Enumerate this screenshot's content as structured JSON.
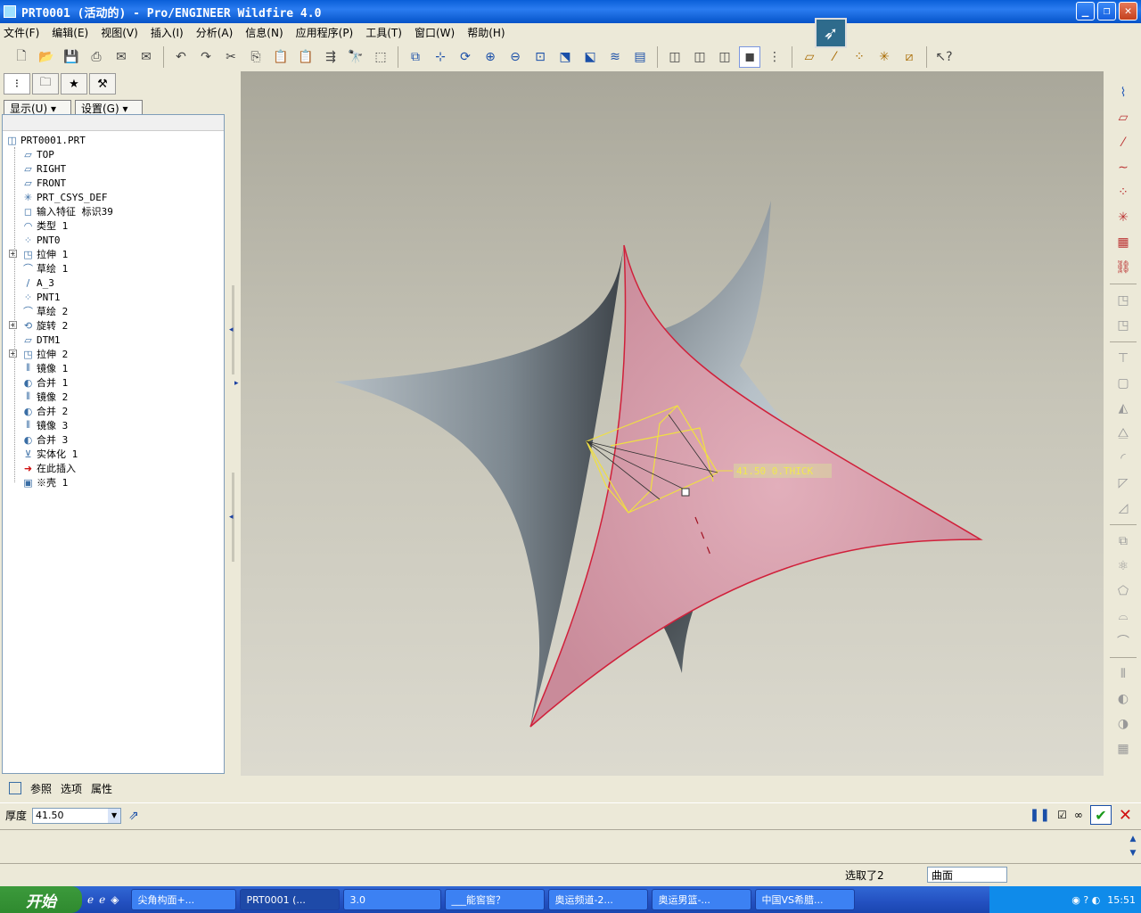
{
  "window": {
    "title": "PRT0001 (活动的) - Pro/ENGINEER Wildfire 4.0",
    "minimize": "_",
    "maximize": "❐",
    "close": "✕"
  },
  "menu": [
    "文件(F)",
    "编辑(E)",
    "视图(V)",
    "插入(I)",
    "分析(A)",
    "信息(N)",
    "应用程序(P)",
    "工具(T)",
    "窗口(W)",
    "帮助(H)"
  ],
  "panel": {
    "show_label": "显示(U) ▾",
    "settings_label": "设置(G) ▾"
  },
  "tree": [
    {
      "label": "PRT0001.PRT",
      "icon": "part-icon",
      "glyph": "◫"
    },
    {
      "label": "TOP",
      "icon": "datum-plane-icon",
      "glyph": "▱"
    },
    {
      "label": "RIGHT",
      "icon": "datum-plane-icon",
      "glyph": "▱"
    },
    {
      "label": "FRONT",
      "icon": "datum-plane-icon",
      "glyph": "▱"
    },
    {
      "label": "PRT_CSYS_DEF",
      "icon": "csys-icon",
      "glyph": "✳"
    },
    {
      "label": "输入特征 标识39",
      "icon": "import-icon",
      "glyph": "◻"
    },
    {
      "label": "类型 1",
      "icon": "feature-icon",
      "glyph": "◠"
    },
    {
      "label": "PNT0",
      "icon": "datum-point-icon",
      "glyph": "⁘"
    },
    {
      "label": "拉伸 1",
      "icon": "extrude-icon",
      "glyph": "◳",
      "expandable": true
    },
    {
      "label": "草绘 1",
      "icon": "sketch-icon",
      "glyph": "⌒"
    },
    {
      "label": "A_3",
      "icon": "axis-icon",
      "glyph": "/"
    },
    {
      "label": "PNT1",
      "icon": "datum-point-icon",
      "glyph": "⁘"
    },
    {
      "label": "草绘 2",
      "icon": "sketch-icon",
      "glyph": "⌒"
    },
    {
      "label": "旋转 2",
      "icon": "revolve-icon",
      "glyph": "⟲",
      "expandable": true
    },
    {
      "label": "DTM1",
      "icon": "datum-plane-icon",
      "glyph": "▱"
    },
    {
      "label": "拉伸 2",
      "icon": "extrude-icon",
      "glyph": "◳",
      "expandable": true
    },
    {
      "label": "镜像 1",
      "icon": "mirror-icon",
      "glyph": "⫴"
    },
    {
      "label": "合并 1",
      "icon": "merge-icon",
      "glyph": "◐"
    },
    {
      "label": "镜像 2",
      "icon": "mirror-icon",
      "glyph": "⫴"
    },
    {
      "label": "合并 2",
      "icon": "merge-icon",
      "glyph": "◐"
    },
    {
      "label": "镜像 3",
      "icon": "mirror-icon",
      "glyph": "⫴"
    },
    {
      "label": "合并 3",
      "icon": "merge-icon",
      "glyph": "◐"
    },
    {
      "label": "实体化 1",
      "icon": "solidify-icon",
      "glyph": "⊻"
    },
    {
      "label": "在此插入",
      "icon": "insert-here-arrow-icon",
      "glyph": "➜"
    },
    {
      "label": "※壳 1",
      "icon": "shell-icon",
      "glyph": "▣"
    }
  ],
  "viewport": {
    "dimension_label": "41.50 0.THICK"
  },
  "dashboard": {
    "tabs": [
      "参照",
      "选项",
      "属性"
    ],
    "thickness_label": "厚度",
    "thickness_value": "41.50"
  },
  "status": {
    "selected_text": "选取了2",
    "filter_value": "曲面"
  },
  "taskbar": {
    "start": "开始",
    "items": [
      "尖角构面+...",
      "PRT0001 (...",
      "3.0",
      "___能窖窖？",
      "奥运频道-2...",
      "奥运男篮-...",
      "中国VS希腊..."
    ],
    "clock": "15:51"
  }
}
